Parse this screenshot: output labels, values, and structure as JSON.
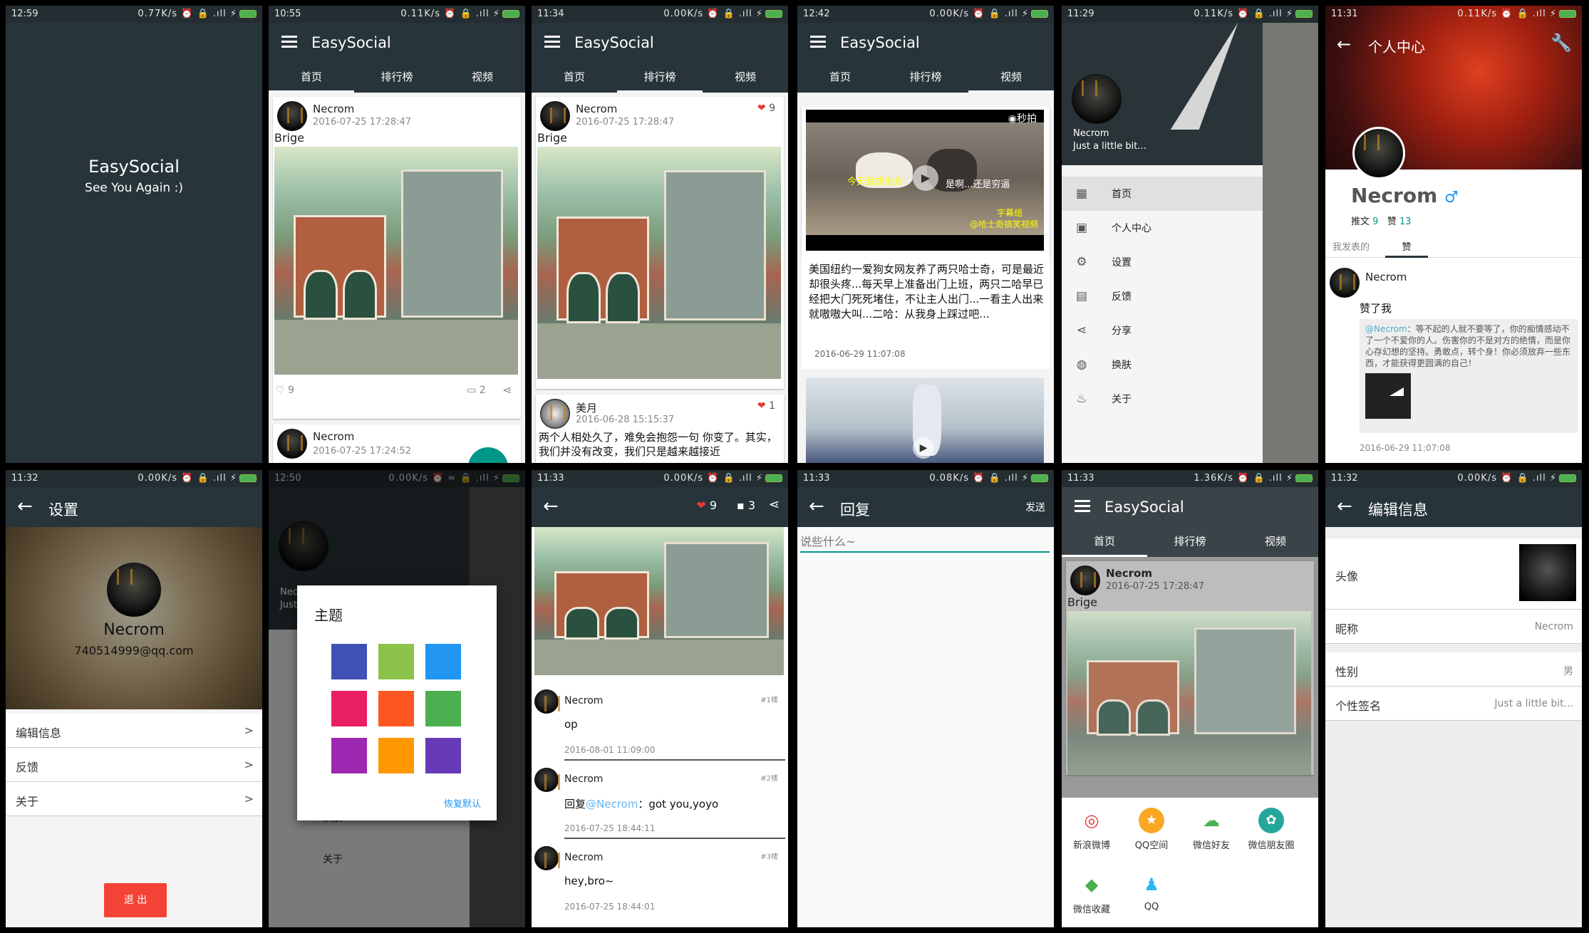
{
  "app": "EasySocial",
  "tabs": [
    "首页",
    "排行榜",
    "视频"
  ],
  "s1": {
    "time": "12:59",
    "net": "0.77K/s",
    "title": "EasySocial",
    "sub": "See You Again :)"
  },
  "s2": {
    "time": "10:55",
    "net": "0.11K/s",
    "user": "Necrom",
    "date": "2016-07-25 17:28:47",
    "text": "Brige",
    "likes": "9",
    "comments": "2",
    "user2": "Necrom",
    "date2": "2016-07-25 17:24:52"
  },
  "s3": {
    "time": "11:34",
    "net": "0.00K/s",
    "user": "Necrom",
    "date": "2016-07-25 17:28:47",
    "text": "Brige",
    "likes": "9",
    "user2": "美月",
    "date2": "2016-06-28 15:15:37",
    "likes2": "1",
    "text2": "两个人相处久了，难免会抱怨一句 你变了。其实，我们并没有改变，我们只是越来越接近"
  },
  "s4": {
    "time": "12:42",
    "net": "0.00K/s",
    "miaopai": "秒拍",
    "cap1": "今天我想出去",
    "cap2": "是啊...还是穷逼",
    "cap3": "字幕组",
    "cap4": "@哈士奇搞笑视频",
    "text": "美国纽约一爱狗女网友养了两只哈士奇，可是最近却很头疼...每天早上准备出门上班，两只二哈早已经把大门死死堵住，不让主人出门...一看主人出来就嗷嗷大叫...二哈：从我身上踩过吧...",
    "date": "2016-06-29 11:07:08"
  },
  "s5": {
    "time": "11:29",
    "net": "0.11K/s",
    "name": "Necrom",
    "sig": "Just a little bit...",
    "items": [
      "首页",
      "个人中心",
      "设置",
      "反馈",
      "分享",
      "换肤",
      "关于"
    ]
  },
  "s6": {
    "time": "11:31",
    "net": "0.11K/s",
    "title": "个人中心",
    "name": "Necrom",
    "gender": "♂",
    "posts_label": "推文",
    "posts": "9",
    "likes_label": "赞",
    "likes": "13",
    "tab1": "我发表的",
    "tab2": "赞",
    "user": "Necrom",
    "action": "赞了我",
    "mention": "@Necrom",
    "quote": "：等不起的人就不要等了，你的痴情感动不了一个不爱你的人。伤害你的不是对方的绝情，而是你心存幻想的坚持。勇敢点，转个身！你必须放弃一些东西，才能获得更圆满的自己！",
    "date": "2016-06-29 11:07:08"
  },
  "s7": {
    "time": "11:32",
    "net": "0.00K/s",
    "title": "设置",
    "name": "Necrom",
    "email": "740514999@qq.com",
    "rows": [
      "编辑信息",
      "反馈",
      "关于"
    ],
    "gt": ">",
    "logout": "退 出"
  },
  "s8": {
    "time": "12:50",
    "net": "0.00K/s",
    "dialog": "主题",
    "reset": "恢复默认",
    "bg_name": "Necr",
    "bg_sig": "Just",
    "bg_item1": "换肤",
    "bg_item2": "关于",
    "swatches": [
      "#3f51b5",
      "#8bc34a",
      "#2196f3",
      "#e91e63",
      "#ff5722",
      "#4caf50",
      "#9c27b0",
      "#ff9800",
      "#673ab7"
    ]
  },
  "s9": {
    "time": "11:33",
    "net": "0.00K/s",
    "likes": "9",
    "comments": "3",
    "comments_list": [
      {
        "user": "Necrom",
        "floor": "#1楼",
        "text": "op",
        "date": "2016-08-01 11:09:00"
      },
      {
        "user": "Necrom",
        "floor": "#2楼",
        "prefix": "回复",
        "mention": "@Necrom",
        "text": "：got you,yoyo",
        "date": "2016-07-25 18:44:11"
      },
      {
        "user": "Necrom",
        "floor": "#3楼",
        "text": "hey,bro~",
        "date": "2016-07-25 18:44:01"
      }
    ]
  },
  "s10": {
    "time": "11:33",
    "net": "0.08K/s",
    "title": "回复",
    "send": "发送",
    "placeholder": "说些什么~"
  },
  "s11": {
    "time": "11:33",
    "net": "1.36K/s",
    "user": "Necrom",
    "date": "2016-07-25 17:28:47",
    "text": "Brige",
    "share": [
      "新浪微博",
      "QQ空间",
      "微信好友",
      "微信朋友圈",
      "微信收藏",
      "QQ"
    ]
  },
  "s12": {
    "time": "11:32",
    "net": "0.00K/s",
    "title": "编辑信息",
    "avatar": "头像",
    "nick_l": "昵称",
    "nick": "Necrom",
    "sex_l": "性别",
    "sex": "男",
    "sig_l": "个性签名",
    "sig": "Just a little bit..."
  },
  "colors": {
    "toolbar": "#27343a",
    "accent": "#009688",
    "red": "#e53935",
    "logout": "#f44336"
  }
}
